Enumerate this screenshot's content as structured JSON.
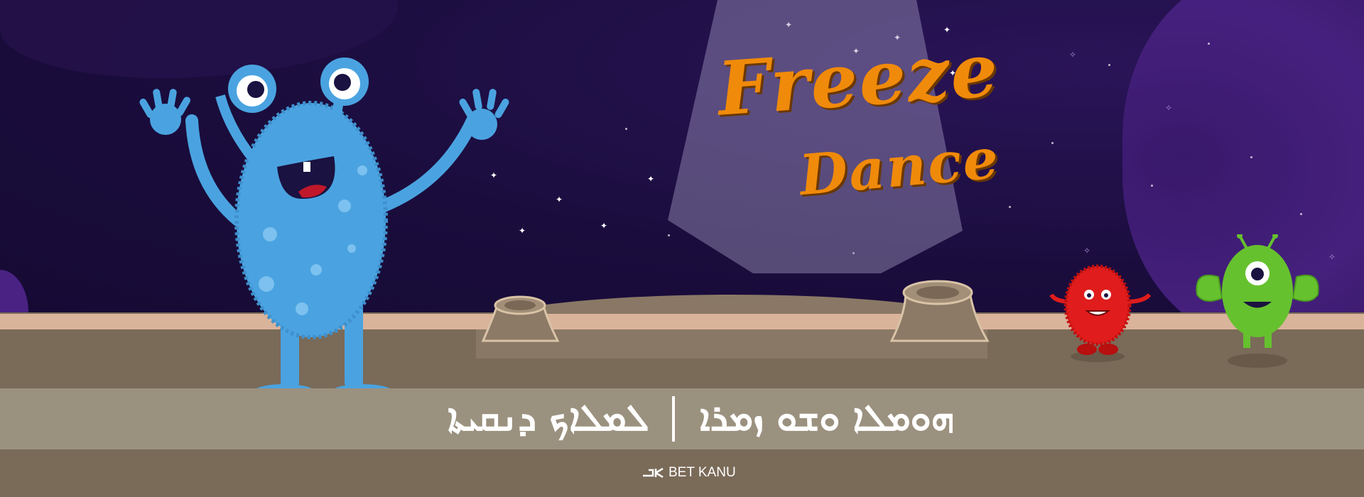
{
  "game": {
    "title_line1": "Freeze",
    "title_line2": "Dance",
    "subtitle_left": "ܠܡܠܐܟ ܕܢܩܝܬܐ",
    "subtitle_right": "ܗܘܡܠܐ ܘܫܘ ܙܡܪܐ",
    "brand": "BET KANU"
  },
  "colors": {
    "sky": "#1b0e3f",
    "title": "#f08a0a",
    "ground": "#7a6a58",
    "banner": "#9b917f",
    "blue_monster": "#4aa3e0",
    "red_monster": "#e01c1c",
    "green_monster": "#66c12e"
  },
  "icons": {
    "brand_logo": "bet-kanu-logo-icon",
    "characters": [
      "blue-monster",
      "red-monster",
      "green-monster"
    ]
  }
}
